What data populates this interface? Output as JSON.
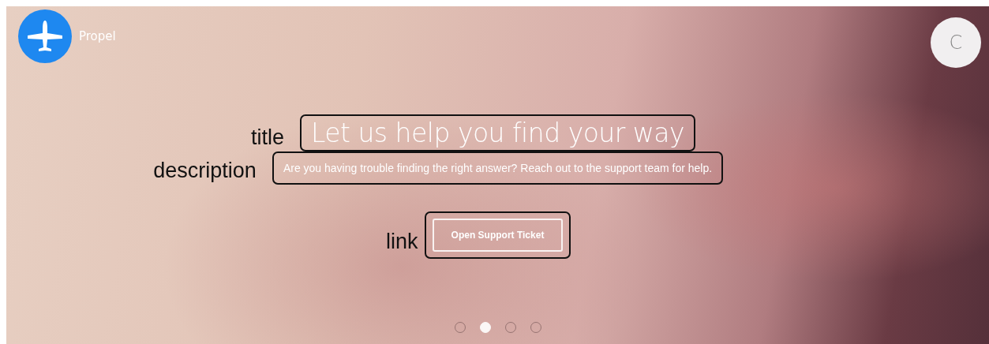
{
  "brand": {
    "name": "Propel"
  },
  "user": {
    "initial": "C"
  },
  "hero": {
    "title": {
      "text": "Let us help you find your way",
      "annotation": "title"
    },
    "description": {
      "text": "Are you having trouble finding the right answer? Reach out to the support team for help.",
      "annotation": "description"
    },
    "link": {
      "text": "Open Support Ticket",
      "annotation": "link"
    }
  },
  "carousel": {
    "dots": [
      {
        "selected": false
      },
      {
        "selected": true
      },
      {
        "selected": false
      },
      {
        "selected": false
      }
    ]
  }
}
